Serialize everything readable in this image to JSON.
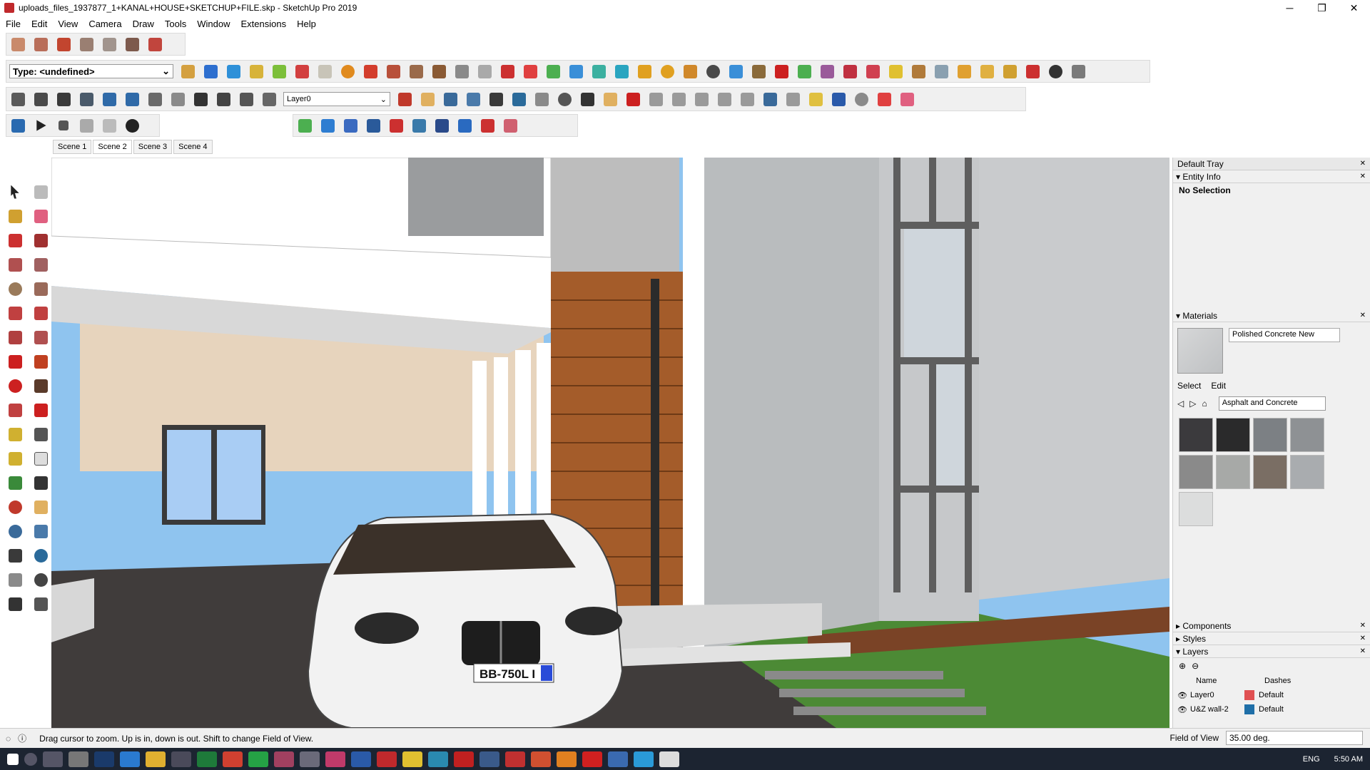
{
  "window": {
    "title": "uploads_files_1937877_1+KANAL+HOUSE+SKETCHUP+FILE.skp - SketchUp Pro 2019",
    "minimize": "─",
    "maximize": "❐",
    "close": "✕"
  },
  "menu": [
    "File",
    "Edit",
    "View",
    "Camera",
    "Draw",
    "Tools",
    "Window",
    "Extensions",
    "Help"
  ],
  "toolbar": {
    "type_field": "Type: <undefined>",
    "layer_selected": "Layer0",
    "dropdown": "⌄"
  },
  "scenes": [
    "Scene 1",
    "Scene 2",
    "Scene 3",
    "Scene 4"
  ],
  "colors": {
    "accent": "#1e73be",
    "taskbar": "#1c2431"
  },
  "tray": {
    "title": "Default Tray",
    "entity_info": {
      "header": "Entity Info",
      "status": "No Selection"
    },
    "materials": {
      "header": "Materials",
      "current": "Polished Concrete New",
      "tab_select": "Select",
      "tab_edit": "Edit",
      "library": "Asphalt and Concrete",
      "swatches": [
        "#3b3a3d",
        "#2a2a2b",
        "#7c8084",
        "#8e9194",
        "#8a8a8a",
        "#a7a9a7",
        "#7a6e64",
        "#a9acaf",
        "#dcdddd"
      ]
    },
    "components": {
      "header": "Components"
    },
    "styles": {
      "header": "Styles"
    },
    "layers": {
      "header": "Layers",
      "col_name": "Name",
      "col_dashes": "Dashes",
      "rows": [
        {
          "name": "Layer0",
          "color": "#e05052",
          "dashes": "Default"
        },
        {
          "name": "U&Z wall-2",
          "color": "#1f6fa8",
          "dashes": "Default"
        }
      ]
    }
  },
  "status": {
    "message": "Drag cursor to zoom.  Up is in, down is out. Shift to change Field of View.",
    "fov_label": "Field of View",
    "fov_value": "35.00 deg."
  },
  "license_plate": "BB-750L I",
  "taskbar": {
    "language": "ENG",
    "time": "5:50 AM"
  }
}
